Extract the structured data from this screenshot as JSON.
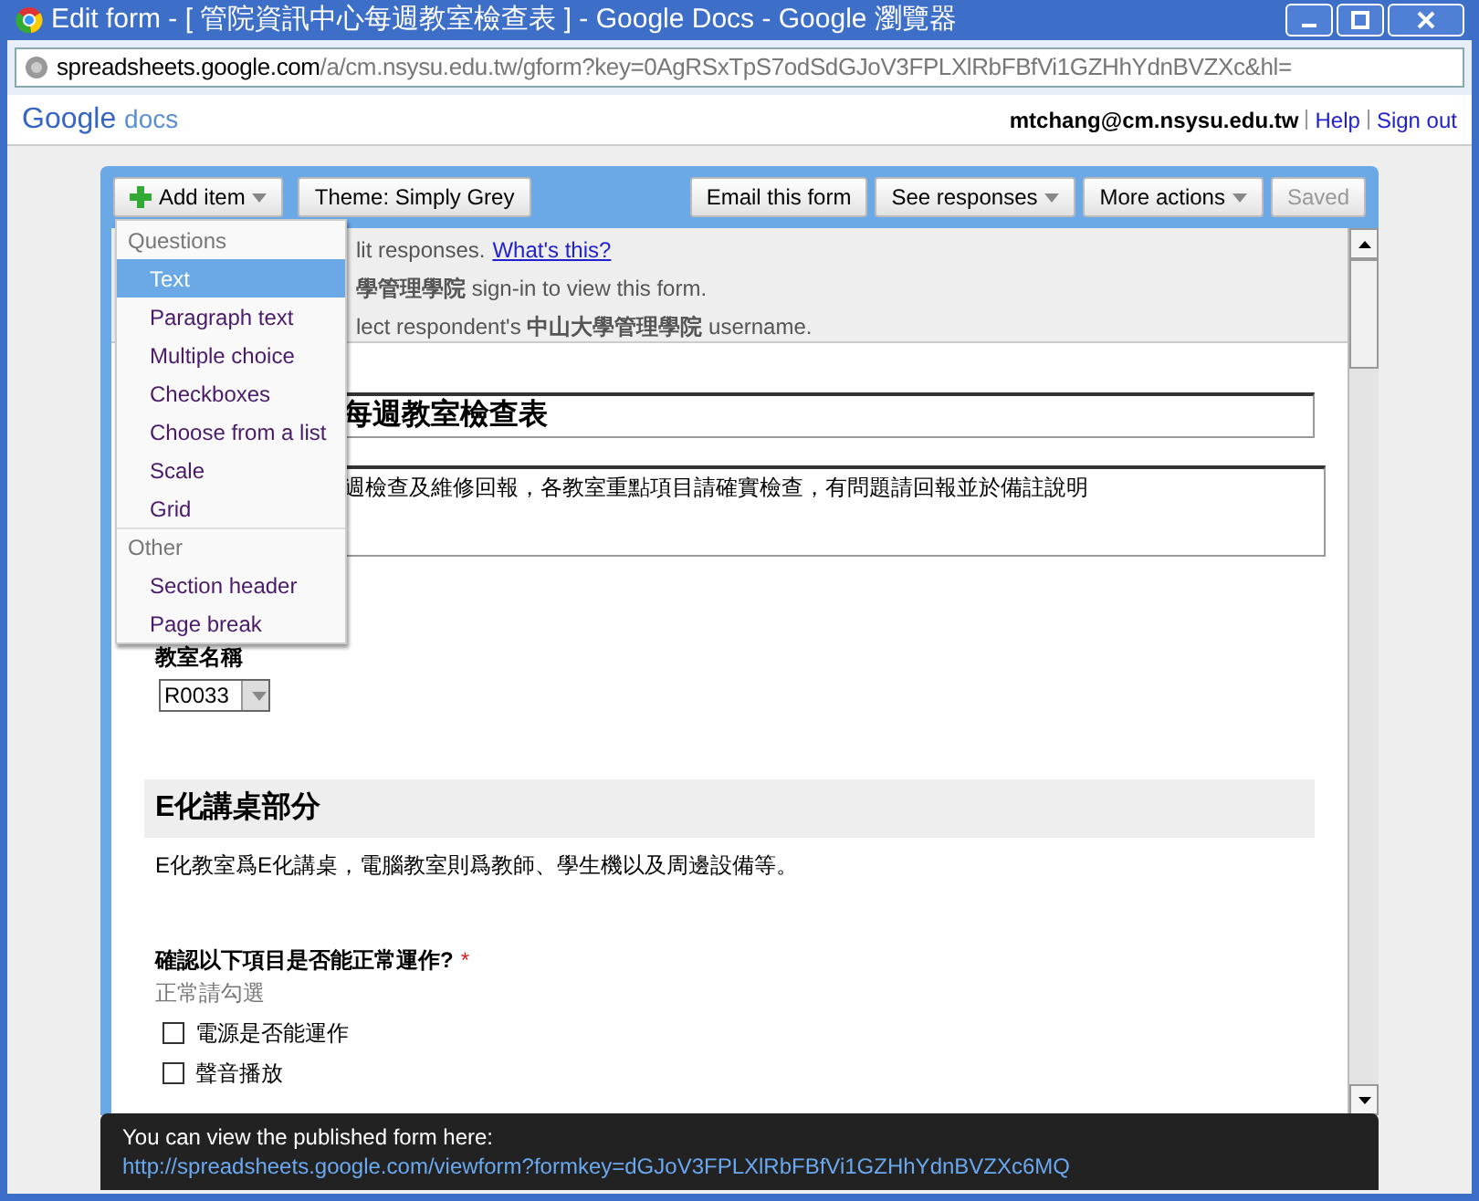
{
  "window": {
    "title": "Edit form - [ 管院資訊中心每週教室檢查表 ] - Google Docs - Google 瀏覽器"
  },
  "address_bar": {
    "host": "spreadsheets.google.com",
    "path": "/a/cm.nsysu.edu.tw/gform?key=0AgRSxTpS7odSdGJoV3FPLXlRbFBfVi1GZHhYdnBVZXc&hl="
  },
  "header": {
    "logo_main": "Google",
    "logo_sub": "docs",
    "user": "mtchang@cm.nsysu.edu.tw",
    "links": [
      "Help",
      "Sign out"
    ]
  },
  "toolbar": {
    "left": [
      {
        "label": "Add item",
        "dropdown": true,
        "plus": true
      },
      {
        "label": "Theme:  Simply Grey",
        "dropdown": false,
        "plus": false
      }
    ],
    "right": [
      {
        "label": "Email this form",
        "dropdown": false,
        "disabled": false
      },
      {
        "label": "See responses",
        "dropdown": true,
        "disabled": false
      },
      {
        "label": "More actions",
        "dropdown": true,
        "disabled": false
      },
      {
        "label": "Saved",
        "dropdown": false,
        "disabled": true
      }
    ]
  },
  "menu": [
    {
      "kind": "header",
      "label": "Questions"
    },
    {
      "kind": "item",
      "label": "Text",
      "selected": true
    },
    {
      "kind": "item",
      "label": "Paragraph text",
      "selected": false
    },
    {
      "kind": "item",
      "label": "Multiple choice",
      "selected": false
    },
    {
      "kind": "item",
      "label": "Checkboxes",
      "selected": false
    },
    {
      "kind": "item",
      "label": "Choose from a list",
      "selected": false
    },
    {
      "kind": "item",
      "label": "Scale",
      "selected": false
    },
    {
      "kind": "item",
      "label": "Grid",
      "selected": false
    },
    {
      "kind": "header",
      "label": "Other"
    },
    {
      "kind": "item",
      "label": "Section header",
      "selected": false
    },
    {
      "kind": "item",
      "label": "Page break",
      "selected": false
    }
  ],
  "notices": [
    {
      "text": "lit responses.",
      "link": "What's this?"
    },
    {
      "text": "**學管理學院** sign-in to view this form."
    },
    {
      "text": "lect respondent's **中山大學管理學院** username."
    }
  ],
  "form": {
    "title": "每週教室檢查表",
    "description": "週檢查及維修回報，各教室重點項目請確實檢查，有問題請回報並於備註說明",
    "field": {
      "label": "教室名稱",
      "value": "R0033"
    },
    "section": {
      "title": "E化講桌部分",
      "description": "E化教室爲E化講桌，電腦教室則爲教師、學生機以及周邊設備等。"
    },
    "question": {
      "title": "確認以下項目是否能正常運作?",
      "required": "*",
      "help": "正常請勾選",
      "options": [
        {
          "label": "電源是否能運作",
          "checked": false
        },
        {
          "label": "聲音播放",
          "checked": false
        }
      ]
    }
  },
  "banner": {
    "text": "You can view the published form here:",
    "link": "http://spreadsheets.google.com/viewform?formkey=dGJoV3FPLXlRbFBfVi1GZHhYdnBVZXc6MQ"
  }
}
